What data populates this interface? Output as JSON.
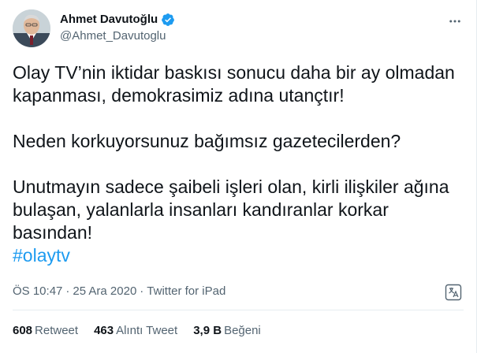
{
  "user": {
    "display_name": "Ahmet Davutoğlu",
    "handle": "@Ahmet_Davutoglu",
    "verified": true
  },
  "tweet": {
    "paragraph_1": "Olay TV’nin iktidar baskısı sonucu daha bir ay olmadan kapanması, demokrasimiz adına utançtır!",
    "paragraph_2": "Neden korkuyorsunuz bağımsız gazetecilerden?",
    "paragraph_3": "Unutmayın sadece şaibeli işleri olan, kirli ilişkiler ağına bulaşan, yalanlarla insanları kandıranlar korkar basından!",
    "hashtag": "#olaytv"
  },
  "meta": {
    "time": "ÖS 10:47",
    "separator": "·",
    "date": "25 Ara 2020",
    "source": "Twitter for iPad"
  },
  "stats": {
    "retweets_count": "608",
    "retweets_label": "Retweet",
    "quotes_count": "463",
    "quotes_label": "Alıntı Tweet",
    "likes_count": "3,9 B",
    "likes_label": "Beğeni"
  },
  "icons": {
    "more": "more-options-icon",
    "verified": "verified-badge-icon",
    "translate": "translate-icon"
  },
  "colors": {
    "accent": "#1d9bf0",
    "text": "#0f1419",
    "secondary": "#536471",
    "border": "#e6ecf0"
  }
}
